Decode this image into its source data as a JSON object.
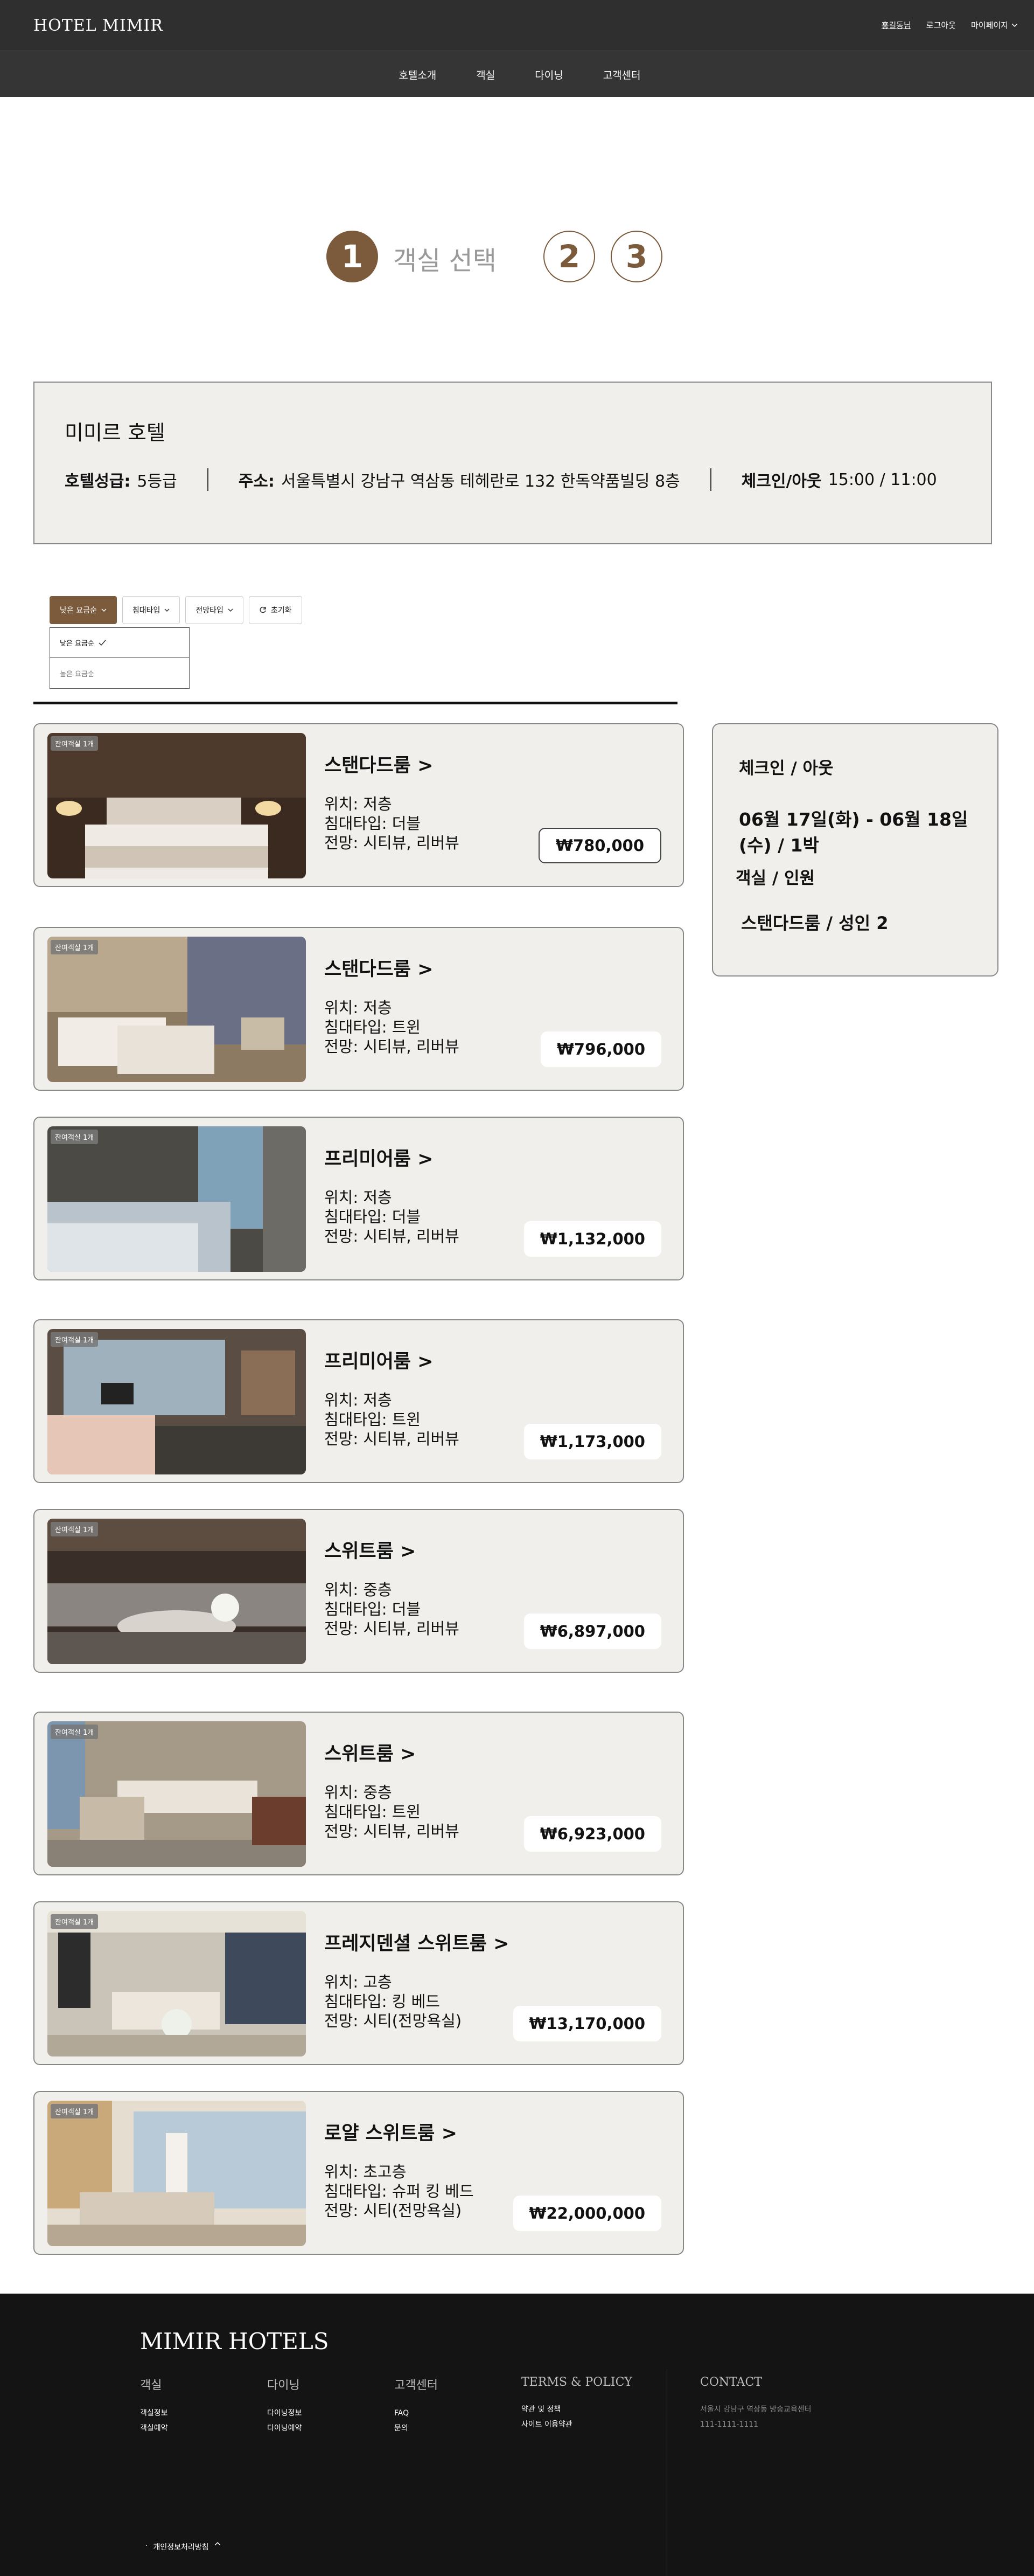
{
  "header": {
    "logo": "HOTEL MIMIR",
    "user_name": "홍길동님",
    "logout": "로그아웃",
    "mypage": "마이페이지",
    "nav": [
      "호텔소개",
      "객실",
      "다이닝",
      "고객센터"
    ]
  },
  "steps": {
    "step1_number": "1",
    "step1_label": "객실 선택",
    "step2_number": "2",
    "step3_number": "3"
  },
  "hotel": {
    "name": "미미르 호텔",
    "grade_label": "호텔성급:",
    "grade_value": "5등급",
    "address_label": "주소:",
    "address_value": "서울특별시 강남구 역삼동 테헤란로 132 한독약품빌딩 8층",
    "checkin_label": "체크인/아웃",
    "checkin_value": "15:00 / 11:00"
  },
  "filters": {
    "sort": "낮은 요금순",
    "bed": "침대타입",
    "view": "전망타입",
    "reset": "초기화",
    "sort_options": [
      "낮은 요금순",
      "높은 요금순"
    ]
  },
  "rooms": [
    {
      "badge": "잔여객실 1개",
      "title": "스탠다드룸 >",
      "location": "위치: 저층",
      "bed": "침대타입: 더블",
      "view": "전망: 시티뷰, 리버뷰",
      "price": "₩780,000"
    },
    {
      "badge": "잔여객실 1개",
      "title": "스탠다드룸 >",
      "location": "위치: 저층",
      "bed": "침대타입: 트윈",
      "view": "전망: 시티뷰, 리버뷰",
      "price": "₩796,000"
    },
    {
      "badge": "잔여객실 1개",
      "title": "프리미어룸 >",
      "location": "위치: 저층",
      "bed": "침대타입: 더블",
      "view": "전망: 시티뷰, 리버뷰",
      "price": "₩1,132,000"
    },
    {
      "badge": "잔여객실 1개",
      "title": "프리미어룸 >",
      "location": "위치: 저층",
      "bed": "침대타입: 트윈",
      "view": "전망: 시티뷰, 리버뷰",
      "price": "₩1,173,000"
    },
    {
      "badge": "잔여객실 1개",
      "title": "스위트룸 >",
      "location": "위치: 중층",
      "bed": "침대타입: 더블",
      "view": "전망: 시티뷰, 리버뷰",
      "price": "₩6,897,000"
    },
    {
      "badge": "잔여객실 1개",
      "title": "스위트룸 >",
      "location": "위치: 중층",
      "bed": "침대타입: 트윈",
      "view": "전망: 시티뷰, 리버뷰",
      "price": "₩6,923,000"
    },
    {
      "badge": "잔여객실 1개",
      "title": "프레지덴셜 스위트룸 >",
      "location": "위치: 고층",
      "bed": "침대타입: 킹 베드",
      "view": "전망: 시티(전망욕실)",
      "price": "₩13,170,000"
    },
    {
      "badge": "잔여객실 1개",
      "title": "로얄 스위트룸 >",
      "location": "위치: 초고층",
      "bed": "침대타입: 슈퍼 킹 베드",
      "view": "전망: 시티(전망욕실)",
      "price": "₩22,000,000"
    }
  ],
  "summary": {
    "checkin_label": "체크인 / 아웃",
    "checkin_value": "06월 17일(화) - 06월 18일(수) / 1박",
    "room_label": "객실 / 인원",
    "room_value": "스탠다드룸 / 성인 2"
  },
  "footer": {
    "logo": "MIMIR HOTELS",
    "col_rooms": {
      "title": "객실",
      "links": [
        "객실정보",
        "객실예약"
      ]
    },
    "col_dining": {
      "title": "다이닝",
      "links": [
        "다이닝정보",
        "다이닝예약"
      ]
    },
    "col_cs": {
      "title": "고객센터",
      "links": [
        "FAQ",
        "문의"
      ]
    },
    "col_terms": {
      "title": "TERMS & POLICY",
      "links": [
        "약관 및 정책",
        "사이트 이용약관"
      ]
    },
    "col_contact": {
      "title": "CONTACT",
      "address": "서울시 강남구 역삼동 방송교육센터",
      "phone": "111-1111-1111"
    },
    "privacy": "개인정보처리방침"
  }
}
